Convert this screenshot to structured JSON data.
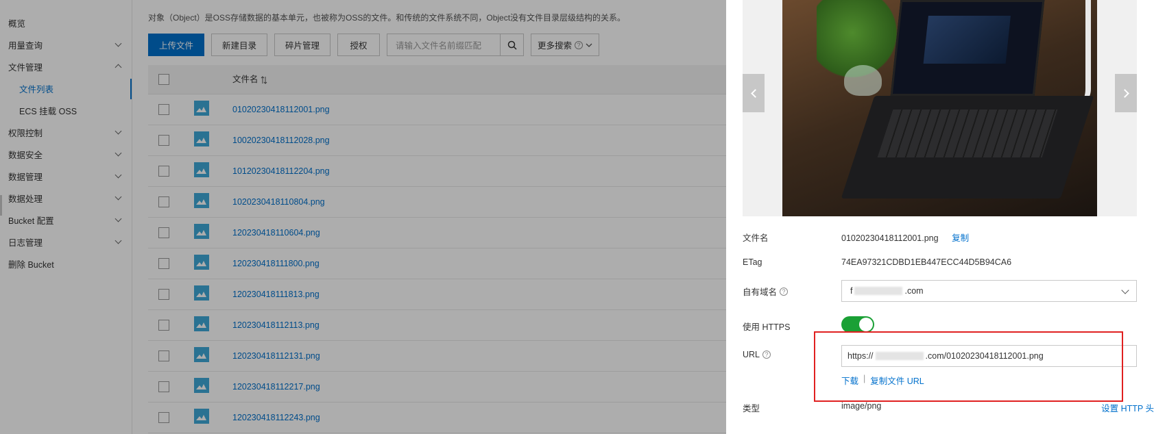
{
  "sidebar": {
    "items": [
      {
        "label": "概览",
        "expandable": false
      },
      {
        "label": "用量查询",
        "expandable": true
      },
      {
        "label": "文件管理",
        "expandable": true,
        "expanded": true
      },
      {
        "label": "文件列表",
        "sub": true,
        "active": true
      },
      {
        "label": "ECS 挂载 OSS",
        "sub": true
      },
      {
        "label": "权限控制",
        "expandable": true
      },
      {
        "label": "数据安全",
        "expandable": true
      },
      {
        "label": "数据管理",
        "expandable": true
      },
      {
        "label": "数据处理",
        "expandable": true
      },
      {
        "label": "Bucket 配置",
        "expandable": true
      },
      {
        "label": "日志管理",
        "expandable": true
      },
      {
        "label": "删除 Bucket",
        "expandable": false
      }
    ]
  },
  "main": {
    "description": "对象（Object）是OSS存储数据的基本单元，也被称为OSS的文件。和传统的文件系统不同，Object没有文件目录层级结构的关系。",
    "toolbar": {
      "upload": "上传文件",
      "new_dir": "新建目录",
      "fragments": "碎片管理",
      "authorize": "授权",
      "search_placeholder": "请输入文件名前缀匹配",
      "more_search": "更多搜索"
    },
    "table": {
      "header_name": "文件名",
      "rows": [
        "01020230418112001.png",
        "10020230418112028.png",
        "10120230418112204.png",
        "1020230418110804.png",
        "120230418110604.png",
        "120230418111800.png",
        "120230418111813.png",
        "120230418112113.png",
        "120230418112131.png",
        "120230418112217.png",
        "120230418112243.png"
      ]
    }
  },
  "panel": {
    "filename_label": "文件名",
    "filename": "01020230418112001.png",
    "copy": "复制",
    "etag_label": "ETag",
    "etag": "74EA97321CDBD1EB447ECC44D5B94CA6",
    "domain_label": "自有域名",
    "domain_prefix": "f",
    "domain_suffix": ".com",
    "https_label": "使用 HTTPS",
    "https_enabled": true,
    "url_label": "URL",
    "url_prefix": "https://",
    "url_suffix": ".com/01020230418112001.png",
    "download": "下载",
    "link_sep": "|",
    "copy_url": "复制文件 URL",
    "type_label": "类型",
    "type": "image/png",
    "set_http_header": "设置 HTTP 头"
  },
  "colors": {
    "accent": "#0070cc",
    "toggle_on": "#1aa035",
    "highlight": "#e02020"
  }
}
